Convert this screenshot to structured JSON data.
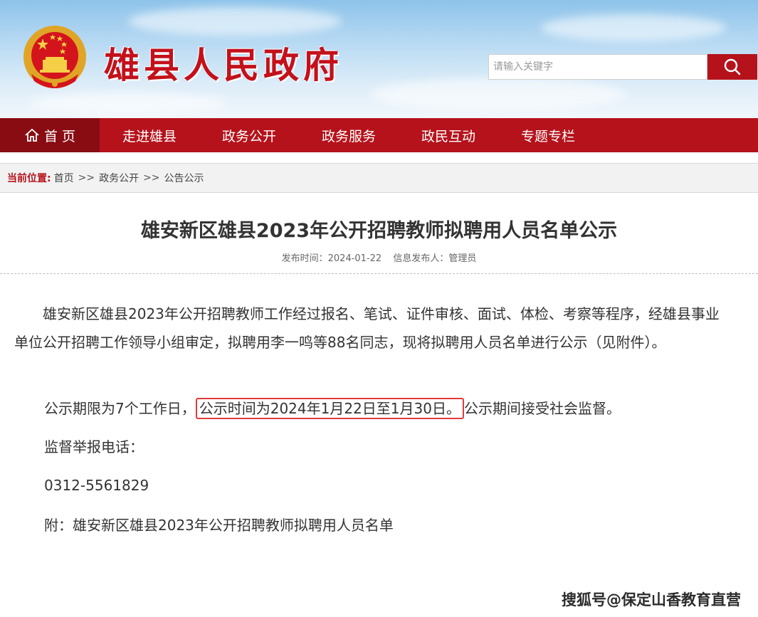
{
  "header": {
    "site_title": "雄县人民政府",
    "search_placeholder": "请输入关键字"
  },
  "nav": {
    "items": [
      {
        "label": "首 页"
      },
      {
        "label": "走进雄县"
      },
      {
        "label": "政务公开"
      },
      {
        "label": "政务服务"
      },
      {
        "label": "政民互动"
      },
      {
        "label": "专题专栏"
      }
    ]
  },
  "breadcrumb": {
    "label": "当前位置:",
    "items": [
      "首页",
      "政务公开",
      "公告公示"
    ],
    "separator": ">>"
  },
  "article": {
    "title": "雄安新区雄县2023年公开招聘教师拟聘用人员名单公示",
    "publish_time": "发布时间：2024-01-22",
    "publisher": "信息发布人：管理员",
    "p1": "雄安新区雄县2023年公开招聘教师工作经过报名、笔试、证件审核、面试、体检、考察等程序，经雄县事业单位公开招聘工作领导小组审定，拟聘用李一鸣等88名同志，现将拟聘用人员名单进行公示（见附件）。",
    "p2_prefix": "公示期限为7个工作日，",
    "p2_highlight": "公示时间为2024年1月22日至1月30日。",
    "p2_suffix": "公示期间接受社会监督。",
    "p3": "监督举报电话：",
    "p4": "0312-5561829",
    "p5": "附：雄安新区雄县2023年公开招聘教师拟聘用人员名单"
  },
  "watermark": "搜狐号@保定山香教育直营",
  "colors": {
    "brand_red": "#b5121b",
    "nav_active": "#8a0c13",
    "highlight_border": "#e23b3b"
  },
  "icons": {
    "emblem": "national-emblem",
    "search": "search-icon",
    "home": "home-icon"
  }
}
